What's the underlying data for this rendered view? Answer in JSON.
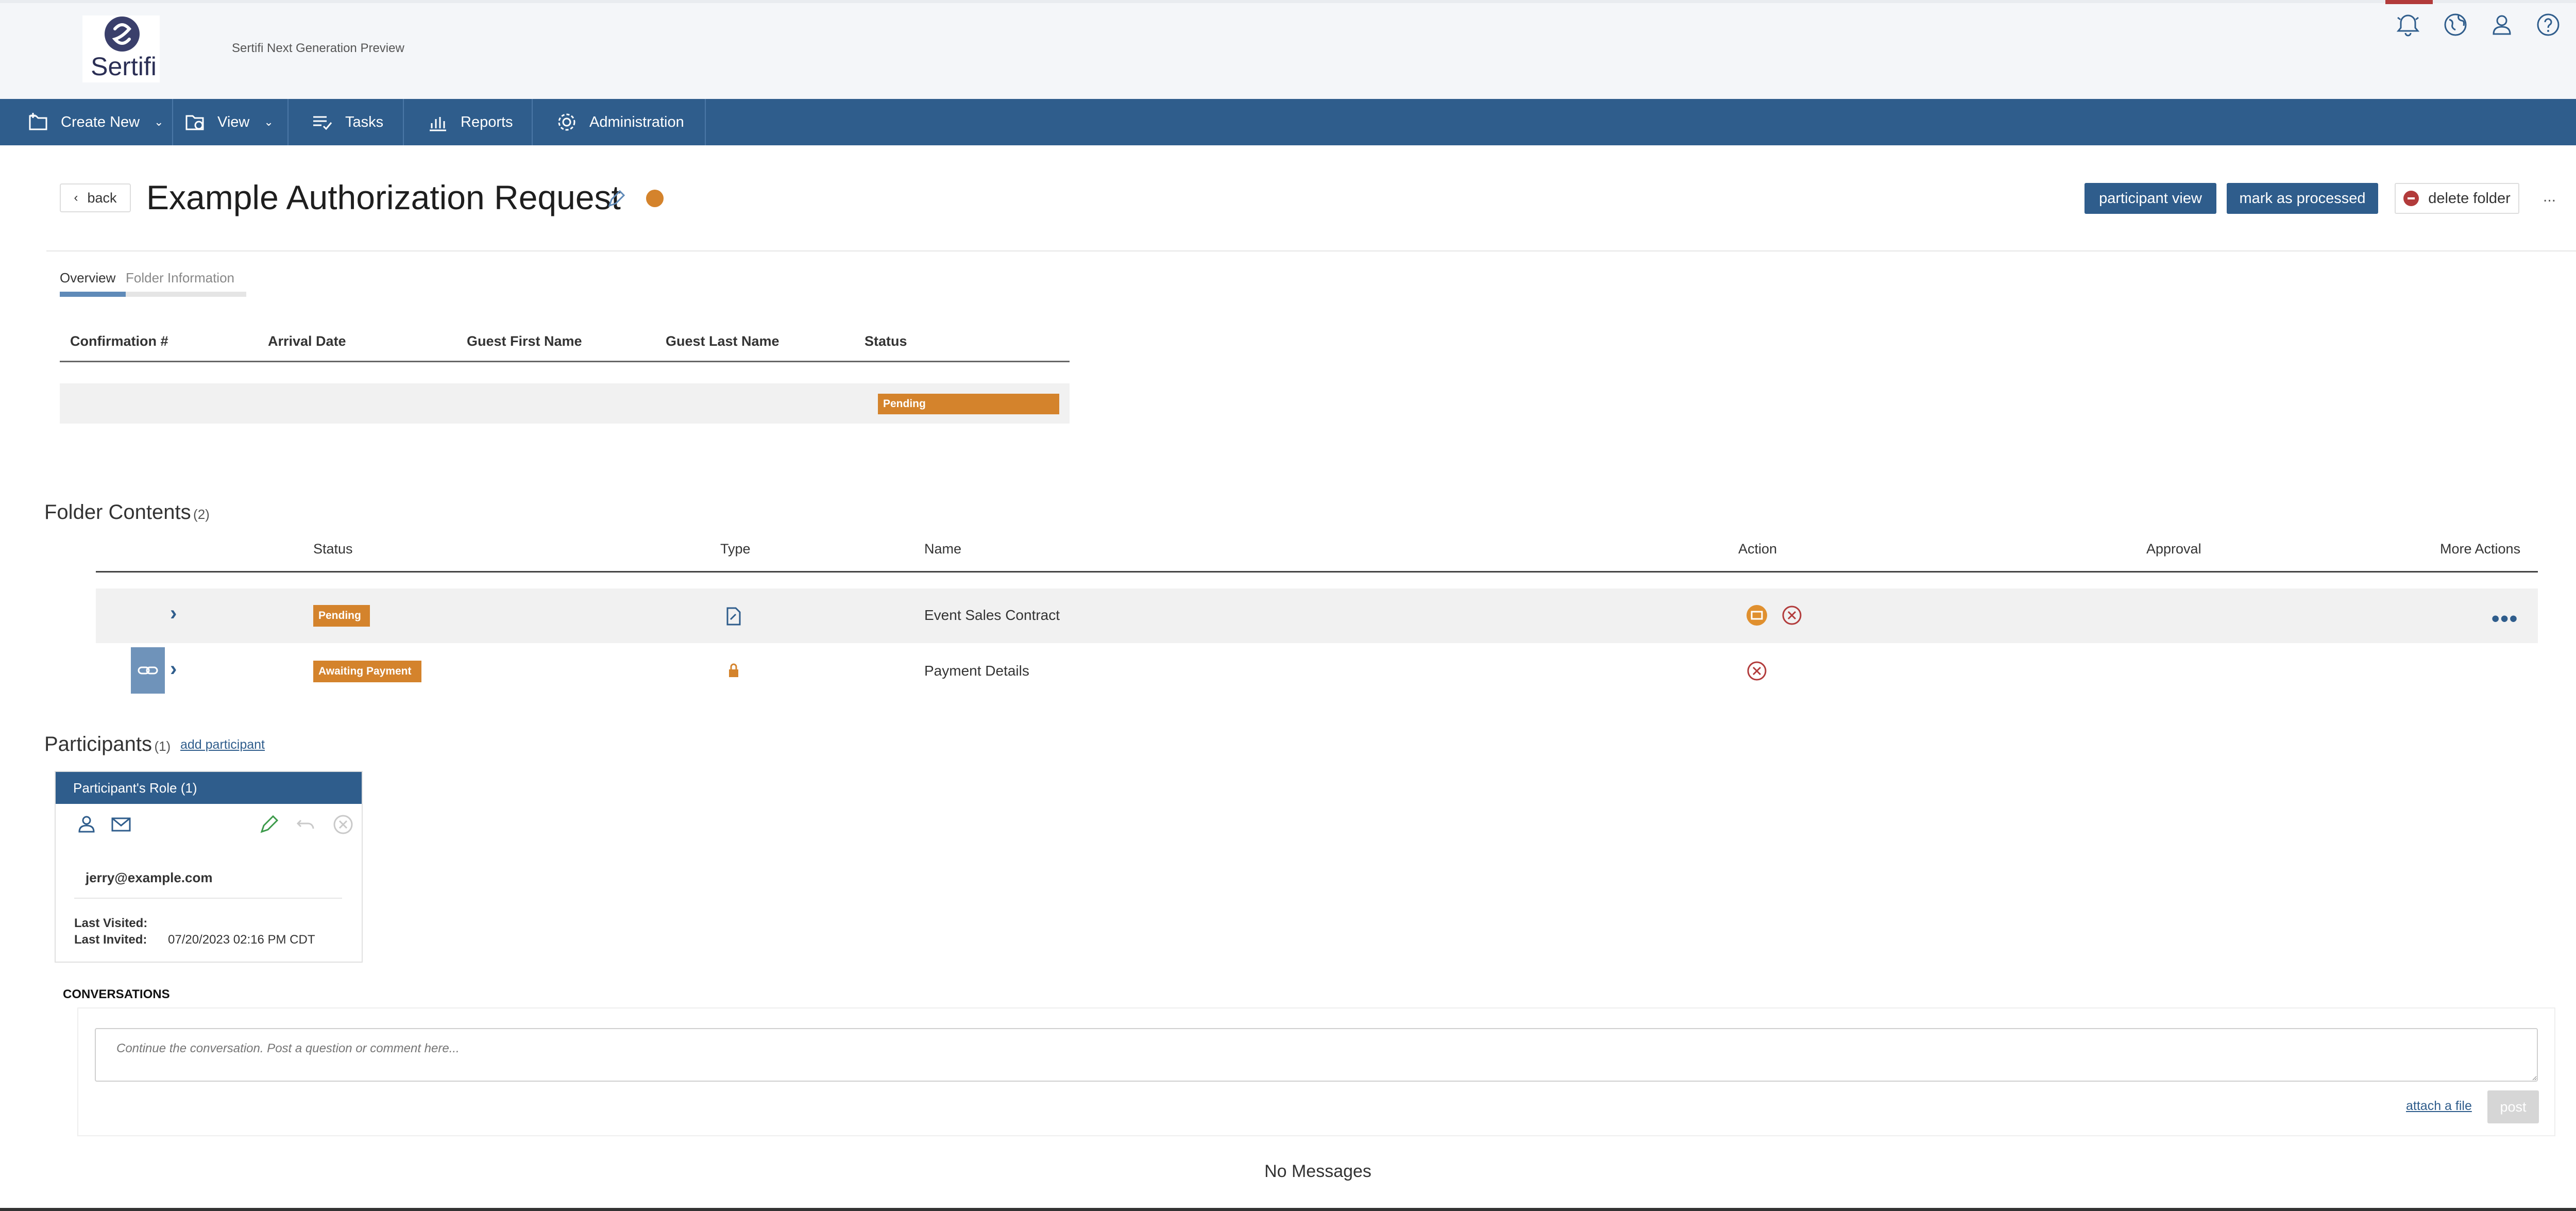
{
  "header": {
    "logo_text": "Sertifi",
    "app_name": "Sertifi Next Generation Preview",
    "icons": [
      "bell-icon",
      "globe-icon",
      "user-icon",
      "help-icon"
    ]
  },
  "nav": {
    "items": [
      {
        "label": "Create New",
        "icon": "new-folder-icon",
        "has_dropdown": true
      },
      {
        "label": "View",
        "icon": "view-folder-icon",
        "has_dropdown": true
      },
      {
        "label": "Tasks",
        "icon": "tasks-icon",
        "has_dropdown": false
      },
      {
        "label": "Reports",
        "icon": "chart-icon",
        "has_dropdown": false
      },
      {
        "label": "Administration",
        "icon": "gear-icon",
        "has_dropdown": false
      }
    ]
  },
  "title_bar": {
    "back_label": "back",
    "title": "Example Authorization Request",
    "participant_view_label": "participant view",
    "mark_processed_label": "mark as processed",
    "delete_folder_label": "delete folder",
    "more_label": "...",
    "status_color": "#d4832c"
  },
  "tabs": [
    {
      "label": "Overview",
      "active": true
    },
    {
      "label": "Folder Information",
      "active": false
    }
  ],
  "overview_table": {
    "headers": [
      "Confirmation #",
      "Arrival Date",
      "Guest First Name",
      "Guest Last Name",
      "Status"
    ],
    "rows": [
      {
        "confirmation": "",
        "arrival_date": "",
        "first_name": "",
        "last_name": "",
        "status": "Pending"
      }
    ]
  },
  "folder_contents": {
    "title": "Folder Contents",
    "count": "(2)",
    "headers": [
      "Status",
      "Type",
      "Name",
      "Action",
      "Approval",
      "More Actions"
    ],
    "rows": [
      {
        "status": "Pending",
        "type_icon": "document-icon",
        "name": "Event Sales Contract",
        "actions": [
          "sign-icon",
          "cancel-icon"
        ],
        "linked": false
      },
      {
        "status": "Awaiting Payment",
        "type_icon": "lock-icon",
        "name": "Payment Details",
        "actions": [
          "cancel-icon"
        ],
        "linked": true
      }
    ]
  },
  "participants": {
    "title": "Participants",
    "count": "(1)",
    "add_label": "add participant",
    "card": {
      "role": "Participant's Role (1)",
      "email": "jerry@example.com",
      "last_visited_label": "Last Visited:",
      "last_visited_value": "",
      "last_invited_label": "Last Invited:",
      "last_invited_value": "07/20/2023 02:16 PM CDT"
    }
  },
  "conversations": {
    "title": "CONVERSATIONS",
    "placeholder": "Continue the conversation. Post a question or comment here...",
    "attach_label": "attach a file",
    "post_label": "post",
    "empty_label": "No Messages"
  },
  "colors": {
    "brand": "#2f5d8c",
    "pending": "#d4832c",
    "danger": "#b23b3b"
  }
}
